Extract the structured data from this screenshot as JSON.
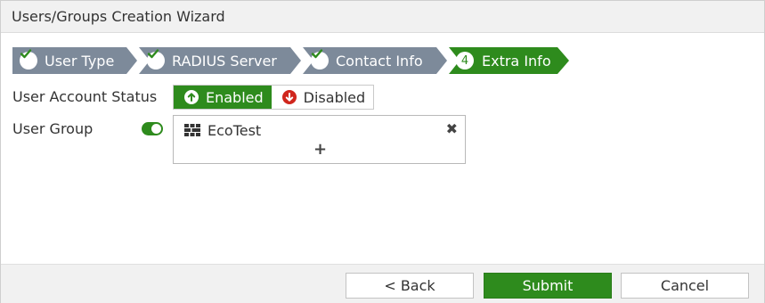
{
  "dialog": {
    "title": "Users/Groups Creation Wizard"
  },
  "steps": [
    {
      "label": "User Type",
      "state": "done",
      "icon": "check-icon"
    },
    {
      "label": "RADIUS Server",
      "state": "done",
      "icon": "check-icon"
    },
    {
      "label": "Contact Info",
      "state": "done",
      "icon": "check-icon"
    },
    {
      "number": "4",
      "label": "Extra Info",
      "state": "current"
    }
  ],
  "colors": {
    "accent": "#2e8b1d",
    "step_done": "#7d8a9a",
    "disabled_icon": "#d0261d"
  },
  "form": {
    "status_label": "User Account Status",
    "status_options": {
      "enabled": "Enabled",
      "disabled": "Disabled",
      "selected": "Enabled"
    },
    "group_label": "User Group",
    "group_toggle_on": true,
    "groups": [
      {
        "name": "EcoTest",
        "icon": "group-icon"
      }
    ],
    "add_symbol": "+",
    "remove_symbol": "✖"
  },
  "footer": {
    "back_label": "< Back",
    "submit_label": "Submit",
    "cancel_label": "Cancel"
  }
}
